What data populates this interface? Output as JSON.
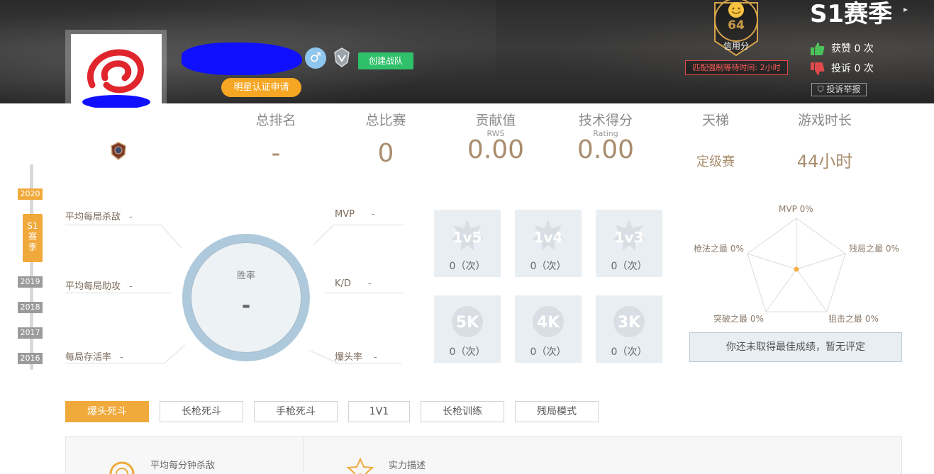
{
  "header": {
    "gender_symbol": "♂",
    "create_team_label": "创建战队",
    "star_cert_label": "明星认证申请",
    "credit": {
      "score": "64",
      "label": "信用分"
    },
    "match_wait": "匹配强制等待时间: 2小时",
    "season_title": "S1赛季",
    "season_arrow": "▸",
    "likes": {
      "label": "获赞",
      "count": "0",
      "unit": "次"
    },
    "complains": {
      "label": "投诉",
      "count": "0",
      "unit": "次"
    },
    "report_label": "投诉举报"
  },
  "stats": {
    "total_rank": {
      "label": "总排名",
      "value": "-"
    },
    "total_matches": {
      "label": "总比赛",
      "value": "0"
    },
    "contribution": {
      "label": "贡献值",
      "sub": "RWS",
      "value": "0.00"
    },
    "skill": {
      "label": "技术得分",
      "sub": "Rating",
      "value": "0.00"
    },
    "ladder": {
      "label": "天梯",
      "value": "定级赛"
    },
    "playtime": {
      "label": "游戏时长",
      "value": "44小时"
    }
  },
  "timeline": {
    "years": [
      "2020",
      "2019",
      "2018",
      "2017",
      "2016"
    ],
    "active_year": "2020",
    "season_tab": [
      "S1",
      "赛",
      "季"
    ]
  },
  "left_stats": {
    "avg_kills": {
      "label": "平均每局杀敌",
      "value": "-"
    },
    "avg_assists": {
      "label": "平均每局助攻",
      "value": "-"
    },
    "survival": {
      "label": "每局存活率",
      "value": "-"
    },
    "mvp": {
      "label": "MVP",
      "value": "-"
    },
    "kd": {
      "label": "K/D",
      "value": "-"
    },
    "headshot": {
      "label": "爆头率",
      "value": "-"
    }
  },
  "win_rate": {
    "label": "胜率",
    "value": "-"
  },
  "tiles": [
    {
      "name": "1v5",
      "text": "1v5",
      "count": "0（次）"
    },
    {
      "name": "1v4",
      "text": "1v4",
      "count": "0（次）"
    },
    {
      "name": "1v3",
      "text": "1v3",
      "count": "0（次）"
    },
    {
      "name": "5k",
      "text": "5K",
      "count": "0（次）"
    },
    {
      "name": "4k",
      "text": "4K",
      "count": "0（次）"
    },
    {
      "name": "3k",
      "text": "3K",
      "count": "0（次）"
    }
  ],
  "radar": {
    "mvp": "MVP 0%",
    "gun": "枪法之最 0%",
    "endgame": "残局之最 0%",
    "breach": "突破之最 0%",
    "sniper": "狙击之最 0%"
  },
  "best_message": "你还未取得最佳成绩，暂无评定",
  "modes": [
    "爆头死斗",
    "长枪死斗",
    "手枪死斗",
    "1V1",
    "长枪训练",
    "残局模式"
  ],
  "active_mode": "爆头死斗",
  "panel": {
    "kills_per_min": "平均每分钟杀敌",
    "strength_desc": "实力描述"
  },
  "colors": {
    "accent": "#f0a93b",
    "green": "#2fc06a",
    "value_brown": "#a98d6d",
    "alert_red": "#ff5a5a"
  }
}
